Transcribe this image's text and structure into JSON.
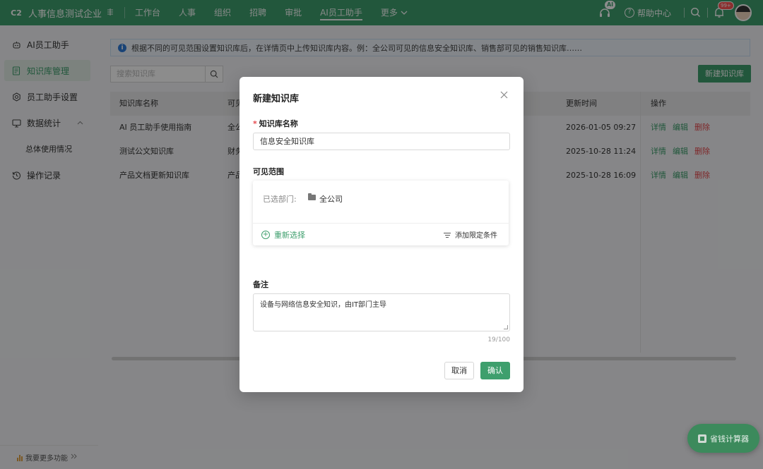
{
  "topbar": {
    "logo_text": "C2",
    "company": "人事信息测试企业",
    "nav": [
      "工作台",
      "人事",
      "组织",
      "招聘",
      "审批",
      "AI员工助手",
      "更多"
    ],
    "active_nav": "AI员工助手",
    "ai_badge": "AI",
    "help_label": "帮助中心",
    "notification_badge": "99+"
  },
  "sidebar": {
    "items": [
      {
        "label": "AI员工助手",
        "icon": "robot-icon"
      },
      {
        "label": "知识库管理",
        "icon": "document-icon",
        "active": true
      },
      {
        "label": "员工助手设置",
        "icon": "gear-icon"
      },
      {
        "label": "数据统计",
        "icon": "monitor-icon"
      },
      {
        "label": "总体使用情况"
      },
      {
        "label": "操作记录",
        "icon": "history-icon"
      }
    ],
    "bottom_label": "我要更多功能"
  },
  "main": {
    "notice": "根据不同的可见范围设置知识库后，在详情页中上传知识库内容。例：全公司可见的信息安全知识库、销售部可见的销售知识库……",
    "search_placeholder": "搜索知识库",
    "new_button": "新建知识库",
    "table": {
      "headers": {
        "name": "知识库名称",
        "scope": "可见",
        "updated": "更新时间",
        "ops": "操作"
      },
      "rows": [
        {
          "name": "AI 员工助手使用指南",
          "scope": "全公",
          "updated": "2026-01-05 09:27"
        },
        {
          "name": "测试公文知识库",
          "scope": "财务",
          "updated": "2025-10-28 11:24"
        },
        {
          "name": "产品文档更新知识库",
          "scope": "产品",
          "updated": "2025-10-28 16:09"
        }
      ],
      "op_labels": {
        "detail": "详情",
        "edit": "编辑",
        "delete": "删除"
      }
    }
  },
  "modal": {
    "title": "新建知识库",
    "name_label": "知识库名称",
    "name_value": "信息安全知识库",
    "scope_label": "可见范围",
    "scope_prefix": "已选部门:",
    "scope_value": "全公司",
    "reselect_label": "重新选择",
    "add_condition_label": "添加限定条件",
    "remark_label": "备注",
    "remark_value": "设备与网络信息安全知识，由IT部门主导",
    "counter": "19/100",
    "cancel_label": "取消",
    "confirm_label": "确认"
  },
  "floating": {
    "calculator_label": "省钱计算器"
  },
  "colors": {
    "brand_green": "#3e9f6d",
    "danger_red": "#e5484d",
    "info_blue": "#2f7bd8"
  }
}
